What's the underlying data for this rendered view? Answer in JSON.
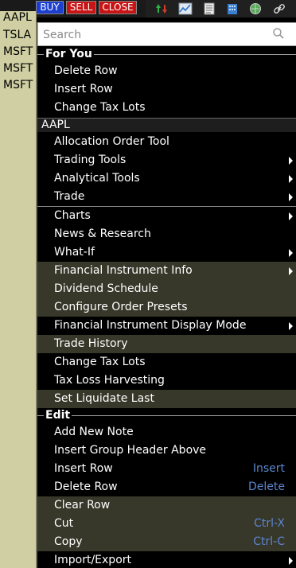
{
  "toolbar": {
    "buy_label": "BUY",
    "sell_label": "SELL",
    "close_label": "CLOSE",
    "buy_color": "#1c3fd0",
    "sell_color": "#c81414",
    "icons": [
      "up-down-arrows-icon",
      "chart-icon",
      "news-page-icon",
      "building-icon",
      "globe-person-icon",
      "link-icon"
    ]
  },
  "watchlist": {
    "symbols": [
      "AAPL",
      "TSLA",
      "MSFT",
      "MSFT",
      "MSFT"
    ]
  },
  "menu": {
    "search_placeholder": "Search",
    "for_you_title": "For You",
    "for_you_items": [
      "Delete Row",
      "Insert Row",
      "Change Tax Lots"
    ],
    "group_label": "AAPL",
    "aapl_items": [
      {
        "label": "Allocation Order Tool",
        "submenu": false
      },
      {
        "label": "Trading Tools",
        "submenu": true
      },
      {
        "label": "Analytical Tools",
        "submenu": true
      },
      {
        "label": "Trade",
        "submenu": true
      }
    ],
    "info_items": [
      {
        "label": "Charts",
        "submenu": true
      },
      {
        "label": "News & Research",
        "submenu": false
      },
      {
        "label": "What-If",
        "submenu": true
      },
      {
        "label": "Financial Instrument Info",
        "submenu": true,
        "highlighted": true
      },
      {
        "label": "Dividend Schedule",
        "submenu": false,
        "highlighted": true
      },
      {
        "label": "Configure Order Presets",
        "submenu": false,
        "highlighted": true
      },
      {
        "label": "Financial Instrument Display Mode",
        "submenu": true
      },
      {
        "label": "Trade History",
        "submenu": false,
        "highlighted": true
      },
      {
        "label": "Change Tax Lots",
        "submenu": false
      },
      {
        "label": "Tax Loss Harvesting",
        "submenu": false
      },
      {
        "label": "Set Liquidate Last",
        "submenu": false,
        "highlighted": true
      }
    ],
    "edit_title": "Edit",
    "edit_items": [
      {
        "label": "Add New Note",
        "shortcut": ""
      },
      {
        "label": "Insert Group Header Above",
        "shortcut": ""
      },
      {
        "label": "Insert Row",
        "shortcut": "Insert"
      },
      {
        "label": "Delete Row",
        "shortcut": "Delete"
      },
      {
        "label": "Clear Row",
        "shortcut": "",
        "highlighted": true
      },
      {
        "label": "Cut",
        "shortcut": "Ctrl-X",
        "highlighted": true
      },
      {
        "label": "Copy",
        "shortcut": "Ctrl-C",
        "highlighted": true
      },
      {
        "label": "Import/Export",
        "shortcut": "",
        "submenu": true
      }
    ],
    "highlight_color": "#37372a",
    "shortcut_color": "#5a86cf"
  }
}
